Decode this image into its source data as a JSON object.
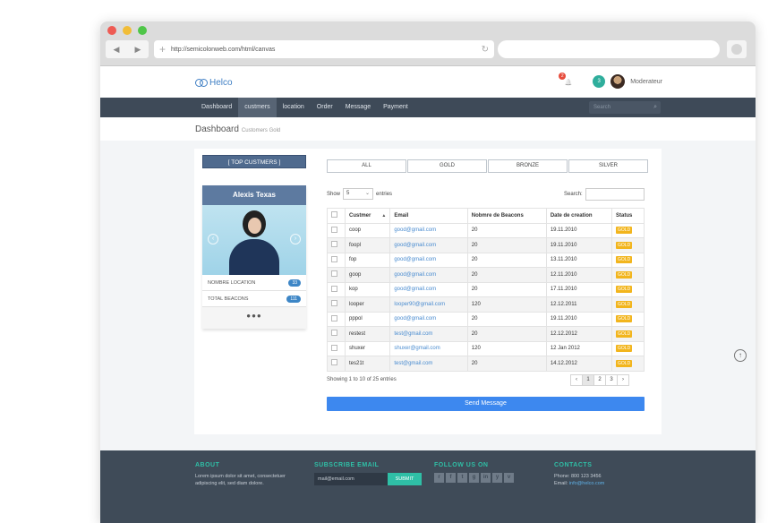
{
  "browser": {
    "url": "http://semicolonweb.com/html/canvas",
    "back_icon": "◀",
    "forward_icon": "▶",
    "plus_icon": "+",
    "reload_icon": "↻"
  },
  "header": {
    "logo_text": "Helco",
    "notification_count": "2",
    "message_count": "3",
    "role": "Moderateur",
    "bell_icon": "🔔"
  },
  "nav": {
    "items": [
      "Dashboard",
      "custmers",
      "location",
      "Order",
      "Message",
      "Payment"
    ],
    "active": "custmers",
    "search_placeholder": "Search",
    "search_icon": "⌕"
  },
  "page": {
    "title": "Dashboard",
    "subtitle": "Customers Gold"
  },
  "sidebar": {
    "top_label": "[ TOP CUSTMERS ]",
    "profile_name": "Alexis Texas",
    "prev_icon": "‹",
    "next_icon": "›",
    "stats": [
      {
        "label": "NOMBRE LOCATION",
        "value": "33"
      },
      {
        "label": "TOTAL BEACONS",
        "value": "111"
      }
    ],
    "dots": "●●●"
  },
  "filters": [
    "ALL",
    "GOLD",
    "BRONZE",
    "SILVER"
  ],
  "table_controls": {
    "show_label": "Show",
    "show_value": "5",
    "chevron_icon": "⌄",
    "entries_label": "entries",
    "search_label": "Search:"
  },
  "table": {
    "columns": [
      "Custmer",
      "Email",
      "Nobmre de Beacons",
      "Date de creation",
      "Status"
    ],
    "sort_icon": "▲",
    "rows": [
      {
        "name": "coop",
        "email": "good@gmail.com",
        "beacons": "20",
        "date": "19.11.2010",
        "status": "GOLD"
      },
      {
        "name": "foopl",
        "email": "good@gmail.com",
        "beacons": "20",
        "date": "19.11.2010",
        "status": "GOLD"
      },
      {
        "name": "fop",
        "email": "good@gmail.com",
        "beacons": "20",
        "date": "13.11.2010",
        "status": "GOLD"
      },
      {
        "name": "goop",
        "email": "good@gmail.com",
        "beacons": "20",
        "date": "12.11.2010",
        "status": "GOLD"
      },
      {
        "name": "kop",
        "email": "good@gmail.com",
        "beacons": "20",
        "date": "17.11.2010",
        "status": "GOLD"
      },
      {
        "name": "looper",
        "email": "looper90@gmail.com",
        "beacons": "120",
        "date": "12.12.2011",
        "status": "GOLD"
      },
      {
        "name": "pppol",
        "email": "good@gmail.com",
        "beacons": "20",
        "date": "19.11.2010",
        "status": "GOLD"
      },
      {
        "name": "restest",
        "email": "test@gmail.com",
        "beacons": "20",
        "date": "12.12.2012",
        "status": "GOLD"
      },
      {
        "name": "shuxer",
        "email": "shuxer@gmail.com",
        "beacons": "120",
        "date": "12 Jan 2012",
        "status": "GOLD"
      },
      {
        "name": "tes21t",
        "email": "test@gmail.com",
        "beacons": "20",
        "date": "14.12.2012",
        "status": "GOLD"
      }
    ],
    "info": "Showing 1 to 10 of 25 entries",
    "pager": [
      "‹",
      "1",
      "2",
      "3",
      "›"
    ],
    "pager_active": "1"
  },
  "send_button": "Send Message",
  "scroll_top_icon": "↑",
  "footer": {
    "about_title": "ABOUT",
    "about_text": "Lorem ipsum dolor sit amet, consectetuer adipiscing elit, sed diam dolore.",
    "subscribe_title": "SUBSCRIBE EMAIL",
    "subscribe_placeholder": "mail@email.com",
    "subscribe_button": "SUBMIT",
    "follow_title": "FOLLOW US ON",
    "social_icons": [
      "rss",
      "facebook",
      "twitter",
      "google-plus",
      "linkedin",
      "youtube",
      "vimeo"
    ],
    "social_glyphs": [
      "r",
      "f",
      "t",
      "g",
      "in",
      "y",
      "v"
    ],
    "contacts_title": "CONTACTS",
    "phone_line": "Phone: 800 123 3456",
    "email_label": "Email:",
    "email_value": "info@helco.com"
  },
  "colors": {
    "nav_bg": "#3e4a58",
    "accent_teal": "#2fbfa6",
    "send_blue": "#3d88ef",
    "gold_badge": "#f2b51d"
  }
}
